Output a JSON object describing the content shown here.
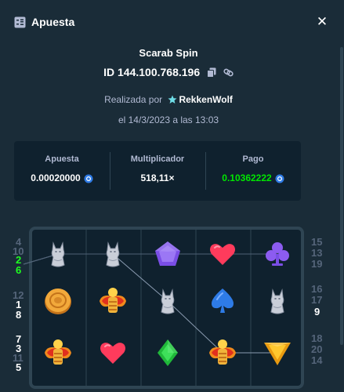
{
  "header": {
    "title": "Apuesta"
  },
  "bet": {
    "game": "Scarab Spin",
    "id": "ID 144.100.768.196",
    "placed_prefix": "Realizada por",
    "user": "RekkenWolf",
    "date": "el 14/3/2023 a las 13:03"
  },
  "stats": {
    "bet_label": "Apuesta",
    "bet_value": "0.00020000",
    "mult_label": "Multiplicador",
    "mult_value": "518,11×",
    "payout_label": "Pago",
    "payout_value": "0.10362222"
  },
  "colors": {
    "accent": "#00e701",
    "coin": "#2e7be6",
    "background": "#1a2c38",
    "panel": "#0f212e"
  },
  "reels": [
    [
      "cat",
      "cat",
      "pentagon",
      "heart",
      "club"
    ],
    [
      "coin",
      "scarab",
      "cat",
      "spade",
      "cat"
    ],
    [
      "scarab",
      "heart",
      "diamond",
      "scarab",
      "triangle"
    ]
  ],
  "paylines": {
    "left_row1": [
      "4",
      "10"
    ],
    "left_row1_hl": [
      "2",
      "6"
    ],
    "left_row2": [
      "12",
      "1",
      "8"
    ],
    "left_row3": [
      "7",
      "3",
      "11",
      "5"
    ],
    "right_row1": [
      "15",
      "13",
      "19"
    ],
    "right_row2": [
      "16",
      "17",
      "9"
    ],
    "right_row3": [
      "18",
      "20",
      "14"
    ]
  }
}
